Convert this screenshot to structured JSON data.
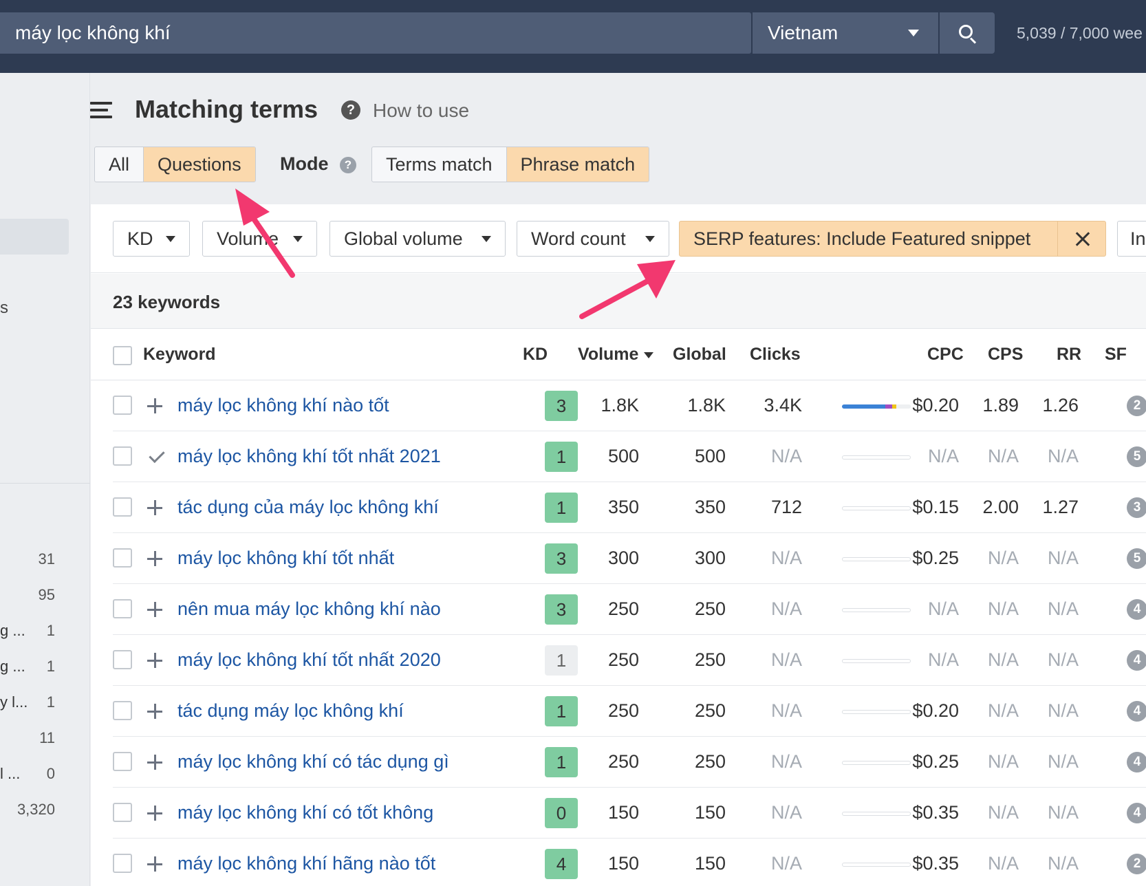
{
  "topbar": {
    "search_value": "máy lọc không khí",
    "country": "Vietnam",
    "credits": "5,039 / 7,000 wee"
  },
  "sidebar": {
    "partial_label": "s",
    "rows": [
      {
        "label": "",
        "num": "31"
      },
      {
        "label": "",
        "num": "95"
      },
      {
        "label": "g ...",
        "num": "1"
      },
      {
        "label": "g ...",
        "num": "1"
      },
      {
        "label": "y l...",
        "num": "1"
      },
      {
        "label": "",
        "num": "11"
      },
      {
        "label": "l ...",
        "num": "0"
      },
      {
        "label": "",
        "num": "3,320"
      }
    ]
  },
  "header": {
    "title": "Matching terms",
    "help_glyph": "?",
    "how_to_use": "How to use"
  },
  "tabs": {
    "all": "All",
    "questions": "Questions",
    "mode_label": "Mode",
    "terms_match": "Terms match",
    "phrase_match": "Phrase match"
  },
  "filters": {
    "kd": "KD",
    "volume": "Volume",
    "global_volume": "Global volume",
    "word_count": "Word count",
    "serp": "SERP features: Include Featured snippet",
    "more": "In"
  },
  "keyword_count": "23 keywords",
  "table": {
    "headers": {
      "keyword": "Keyword",
      "kd": "KD",
      "volume": "Volume",
      "global": "Global",
      "clicks": "Clicks",
      "cpc": "CPC",
      "cps": "CPS",
      "rr": "RR",
      "sf": "SF"
    },
    "rows": [
      {
        "keyword": "máy lọc không khí nào tốt",
        "kd": "3",
        "volume": "1.8K",
        "global": "1.8K",
        "clicks": "3.4K",
        "cpc": "$0.20",
        "cps": "1.89",
        "rr": "1.26",
        "sf": "2"
      },
      {
        "keyword": "máy lọc không khí tốt nhất 2021",
        "kd": "1",
        "volume": "500",
        "global": "500",
        "clicks": "N/A",
        "cpc": "N/A",
        "cps": "N/A",
        "rr": "N/A",
        "sf": "5"
      },
      {
        "keyword": "tác dụng của máy lọc không khí",
        "kd": "1",
        "volume": "350",
        "global": "350",
        "clicks": "712",
        "cpc": "$0.15",
        "cps": "2.00",
        "rr": "1.27",
        "sf": "3"
      },
      {
        "keyword": "máy lọc không khí tốt nhất",
        "kd": "3",
        "volume": "300",
        "global": "300",
        "clicks": "N/A",
        "cpc": "$0.25",
        "cps": "N/A",
        "rr": "N/A",
        "sf": "5"
      },
      {
        "keyword": "nên mua máy lọc không khí nào",
        "kd": "3",
        "volume": "250",
        "global": "250",
        "clicks": "N/A",
        "cpc": "N/A",
        "cps": "N/A",
        "rr": "N/A",
        "sf": "4"
      },
      {
        "keyword": "máy lọc không khí tốt nhất 2020",
        "kd": "1",
        "volume": "250",
        "global": "250",
        "clicks": "N/A",
        "cpc": "N/A",
        "cps": "N/A",
        "rr": "N/A",
        "sf": "4"
      },
      {
        "keyword": "tác dụng máy lọc không khí",
        "kd": "1",
        "volume": "250",
        "global": "250",
        "clicks": "N/A",
        "cpc": "$0.20",
        "cps": "N/A",
        "rr": "N/A",
        "sf": "4"
      },
      {
        "keyword": "máy lọc không khí có tác dụng gì",
        "kd": "1",
        "volume": "250",
        "global": "250",
        "clicks": "N/A",
        "cpc": "$0.25",
        "cps": "N/A",
        "rr": "N/A",
        "sf": "4"
      },
      {
        "keyword": "máy lọc không khí có tốt không",
        "kd": "0",
        "volume": "150",
        "global": "150",
        "clicks": "N/A",
        "cpc": "$0.35",
        "cps": "N/A",
        "rr": "N/A",
        "sf": "4"
      },
      {
        "keyword": "máy lọc không khí hãng nào tốt",
        "kd": "4",
        "volume": "150",
        "global": "150",
        "clicks": "N/A",
        "cpc": "$0.35",
        "cps": "N/A",
        "rr": "N/A",
        "sf": "2"
      }
    ]
  },
  "colors": {
    "topbar": "#2e3b52",
    "link": "#1d56a3",
    "kd_green": "#7fcca0",
    "active_tab": "#fbd9ad",
    "arrow": "#f2386f"
  },
  "icons": [
    "search-icon",
    "caret-down-icon",
    "menu-icon",
    "help-icon",
    "close-icon",
    "plus-icon",
    "check-icon"
  ]
}
